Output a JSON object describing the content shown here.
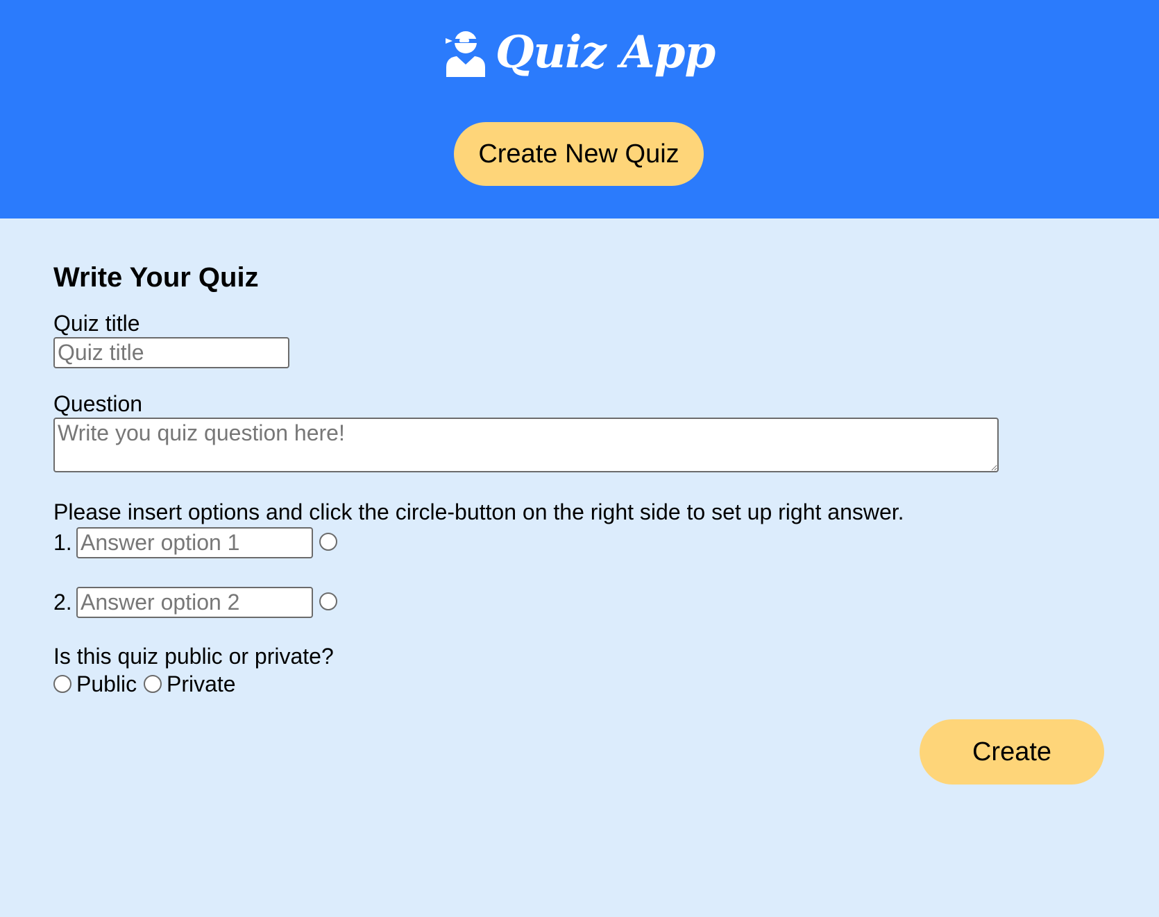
{
  "header": {
    "brand_name": "Quiz App",
    "brand_icon": "ninja-user-icon",
    "create_new_label": "Create New Quiz"
  },
  "form": {
    "heading": "Write Your Quiz",
    "title_label": "Quiz title",
    "title_placeholder": "Quiz title",
    "title_value": "",
    "question_label": "Question",
    "question_placeholder": "Write you quiz question here!",
    "question_value": "",
    "options_instruction": "Please insert options and click the circle-button on the right side to set up right answer.",
    "options": [
      {
        "number": "1.",
        "placeholder": "Answer option 1",
        "value": "",
        "correct": false
      },
      {
        "number": "2.",
        "placeholder": "Answer option 2",
        "value": "",
        "correct": false
      }
    ],
    "privacy_question": "Is this quiz public or private?",
    "privacy_options": [
      {
        "label": "Public",
        "selected": false
      },
      {
        "label": "Private",
        "selected": false
      }
    ],
    "submit_label": "Create"
  },
  "colors": {
    "header_bg": "#2b7bfc",
    "page_bg": "#dcecfc",
    "button_bg": "#fed579"
  }
}
